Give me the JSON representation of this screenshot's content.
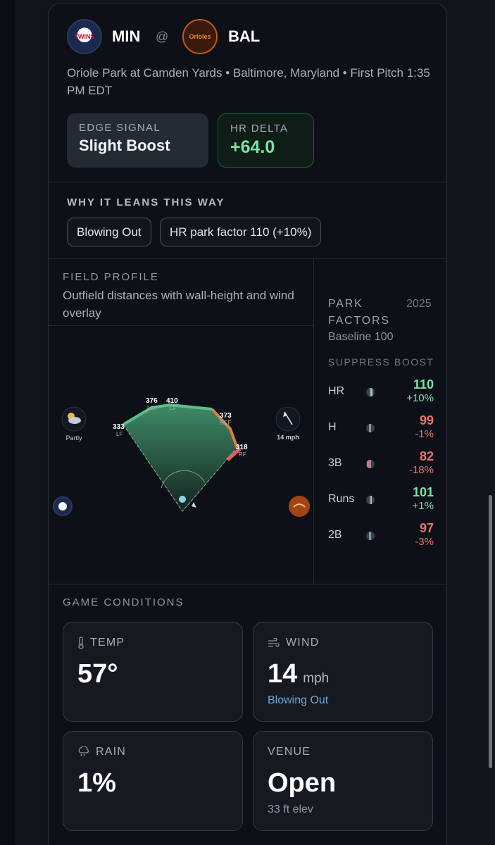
{
  "matchup": {
    "away": {
      "abbr": "MIN",
      "logo_text": "TWINS"
    },
    "separator": "@",
    "home": {
      "abbr": "BAL",
      "logo_text": "Orioles"
    },
    "venue_line": "Oriole Park at Camden Yards • Baltimore, Maryland • First Pitch 1:35 PM EDT"
  },
  "signals": {
    "edge_label": "EDGE SIGNAL",
    "edge_value": "Slight Boost",
    "delta_label": "HR DELTA",
    "delta_value": "+64.0"
  },
  "why": {
    "title": "WHY IT LEANS THIS WAY",
    "chips": [
      "Blowing Out",
      "HR park factor 110 (+10%)"
    ]
  },
  "field_profile": {
    "title": "FIELD PROFILE",
    "subtitle": "Outfield distances with wall-height and wind overlay",
    "distances": [
      {
        "value": "333",
        "pos": "LF"
      },
      {
        "value": "376",
        "pos": "LCF"
      },
      {
        "value": "410",
        "pos": "CF"
      },
      {
        "value": "373",
        "pos": "RCF"
      },
      {
        "value": "318",
        "pos": "RF"
      }
    ],
    "weather_label": "Partly",
    "weather_icon": "partly-cloudy-icon",
    "wind_label": "14 mph",
    "wind_icon": "wind-arrow-icon"
  },
  "park_factors": {
    "title": "PARK FACTORS",
    "year": "2025",
    "baseline": "Baseline 100",
    "suppress_label": "SUPPRESS",
    "boost_label": "BOOST",
    "rows": [
      {
        "name": "HR",
        "value": "110",
        "pct": "+10%",
        "factor": 110
      },
      {
        "name": "H",
        "value": "99",
        "pct": "-1%",
        "factor": 99
      },
      {
        "name": "3B",
        "value": "82",
        "pct": "-18%",
        "factor": 82
      },
      {
        "name": "Runs",
        "value": "101",
        "pct": "+1%",
        "factor": 101
      },
      {
        "name": "2B",
        "value": "97",
        "pct": "-3%",
        "factor": 97
      }
    ],
    "colors": {
      "boost": "#7ae3a4",
      "suppress": "#e8736b",
      "neutral": "#8b939e"
    }
  },
  "conditions": {
    "title": "GAME CONDITIONS",
    "temp": {
      "label": "TEMP",
      "value": "57°"
    },
    "wind": {
      "label": "WIND",
      "value": "14",
      "unit": "mph",
      "sub": "Blowing Out"
    },
    "rain": {
      "label": "RAIN",
      "value": "1%"
    },
    "venue": {
      "label": "VENUE",
      "value": "Open",
      "sub": "33 ft elev"
    }
  }
}
